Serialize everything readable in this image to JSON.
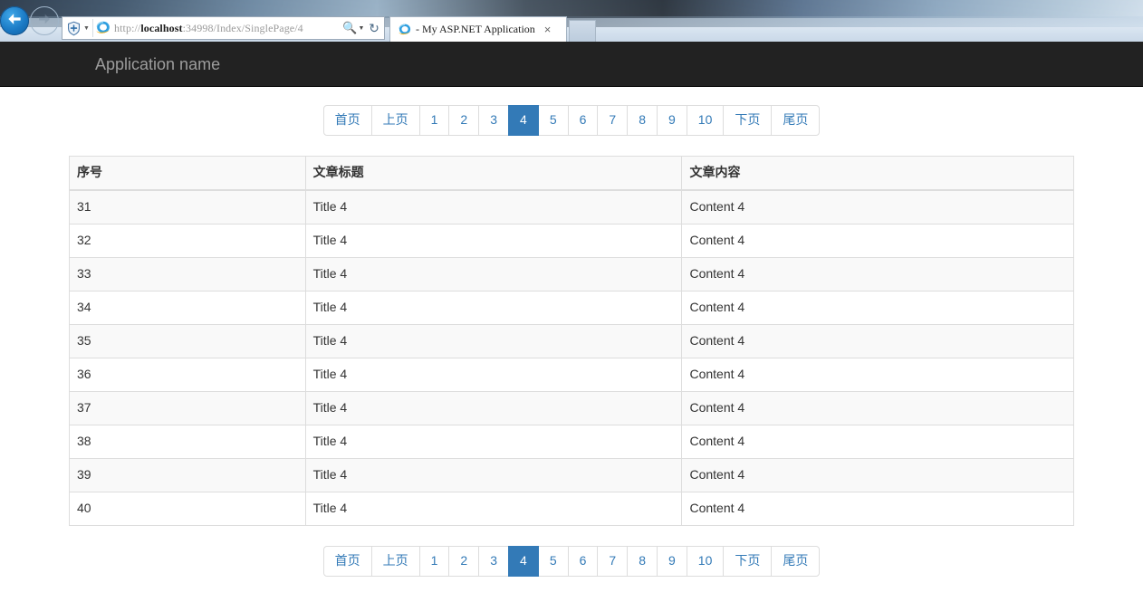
{
  "browser": {
    "back_icon": "back-arrow-icon",
    "forward_icon": "forward-arrow-icon",
    "compat_icon": "compatibility-view-icon",
    "url_scheme": "http://",
    "url_host": "localhost",
    "url_rest": ":34998/Index/SinglePage/4",
    "url_full": "http://localhost:34998/Index/SinglePage/4",
    "search_icon": "search-icon",
    "refresh_icon": "refresh-icon",
    "tab_title": "- My ASP.NET Application",
    "tab_favicon": "internet-explorer-icon",
    "tab_close": "×",
    "new_tab_label": ""
  },
  "navbar": {
    "brand": "Application name",
    "background": "#222222",
    "text_color": "#9d9d9d"
  },
  "pagination": {
    "items": [
      {
        "label": "首页",
        "name": "page-first",
        "active": false
      },
      {
        "label": "上页",
        "name": "page-prev",
        "active": false
      },
      {
        "label": "1",
        "name": "page-1",
        "active": false
      },
      {
        "label": "2",
        "name": "page-2",
        "active": false
      },
      {
        "label": "3",
        "name": "page-3",
        "active": false
      },
      {
        "label": "4",
        "name": "page-4",
        "active": true
      },
      {
        "label": "5",
        "name": "page-5",
        "active": false
      },
      {
        "label": "6",
        "name": "page-6",
        "active": false
      },
      {
        "label": "7",
        "name": "page-7",
        "active": false
      },
      {
        "label": "8",
        "name": "page-8",
        "active": false
      },
      {
        "label": "9",
        "name": "page-9",
        "active": false
      },
      {
        "label": "10",
        "name": "page-10",
        "active": false
      },
      {
        "label": "下页",
        "name": "page-next",
        "active": false
      },
      {
        "label": "尾页",
        "name": "page-last",
        "active": false
      }
    ],
    "current_page": 4,
    "active_color": "#337ab7",
    "link_color": "#337ab7"
  },
  "table": {
    "headers": [
      "序号",
      "文章标题",
      "文章内容"
    ],
    "rows": [
      [
        "31",
        "Title 4",
        "Content 4"
      ],
      [
        "32",
        "Title 4",
        "Content 4"
      ],
      [
        "33",
        "Title 4",
        "Content 4"
      ],
      [
        "34",
        "Title 4",
        "Content 4"
      ],
      [
        "35",
        "Title 4",
        "Content 4"
      ],
      [
        "36",
        "Title 4",
        "Content 4"
      ],
      [
        "37",
        "Title 4",
        "Content 4"
      ],
      [
        "38",
        "Title 4",
        "Content 4"
      ],
      [
        "39",
        "Title 4",
        "Content 4"
      ],
      [
        "40",
        "Title 4",
        "Content 4"
      ]
    ]
  }
}
